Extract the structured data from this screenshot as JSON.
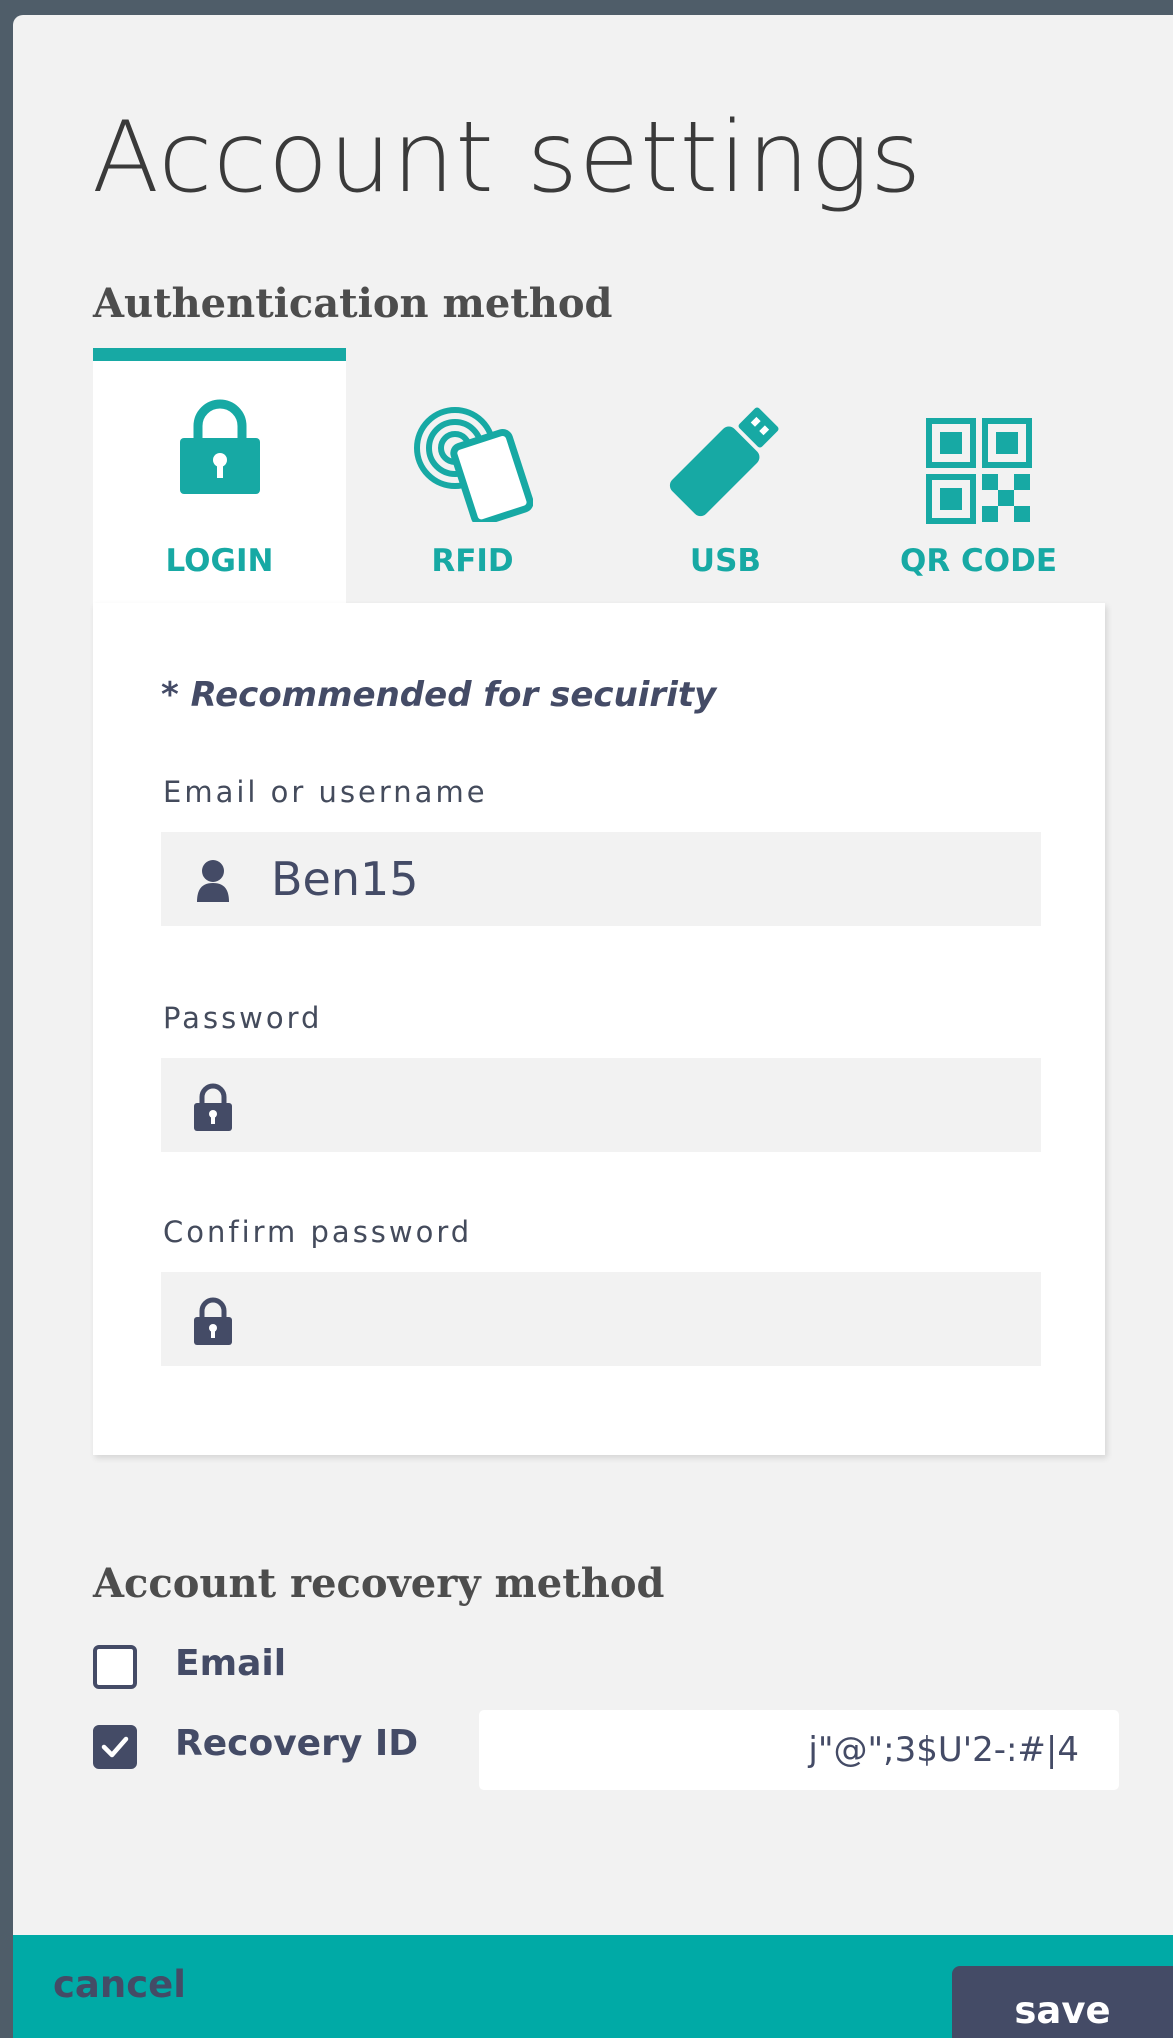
{
  "page": {
    "title": "Account settings",
    "accent_color": "#17a9a4",
    "dark_color": "#444b66"
  },
  "authentication": {
    "heading": "Authentication method",
    "active_tab": "LOGIN",
    "tabs": [
      {
        "label": "LOGIN",
        "icon": "padlock-icon"
      },
      {
        "label": "RFID",
        "icon": "rfid-card-icon"
      },
      {
        "label": "USB",
        "icon": "usb-stick-icon"
      },
      {
        "label": "QR CODE",
        "icon": "qr-code-icon"
      }
    ],
    "note": "* Recommended for secuirity",
    "username": {
      "label": "Email or username",
      "value": "Ben15",
      "icon": "user-icon"
    },
    "password": {
      "label": "Password",
      "value": "",
      "icon": "lock-icon"
    },
    "confirm_password": {
      "label": "Confirm password",
      "value": "",
      "icon": "lock-icon"
    }
  },
  "recovery": {
    "heading": "Account recovery method",
    "email": {
      "label": "Email",
      "checked": false
    },
    "recovery_id": {
      "label": "Recovery ID",
      "checked": true,
      "value": "j\"@\";3$U'2-:#|4"
    }
  },
  "footer": {
    "cancel_label": "cancel",
    "save_label": "save"
  }
}
